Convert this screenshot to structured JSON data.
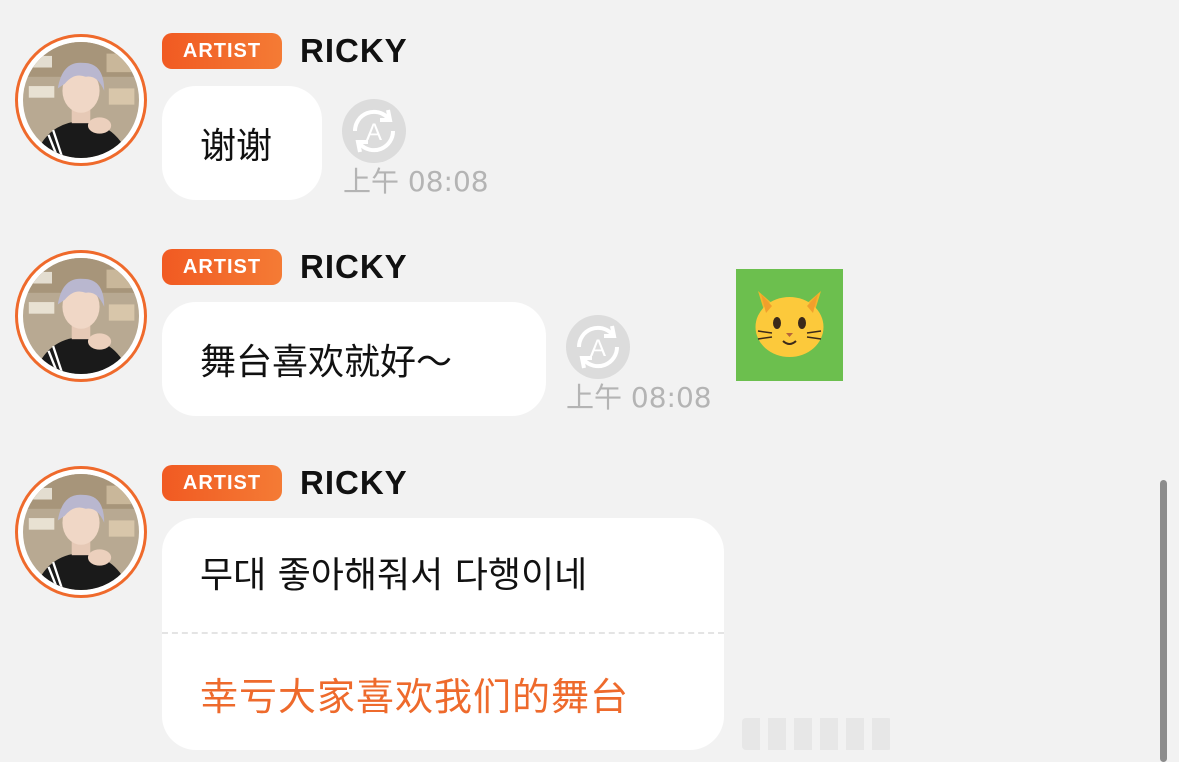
{
  "messages": [
    {
      "badge": "ARTIST",
      "sender": "RICKY",
      "text": "谢谢",
      "time": "上午 08:08"
    },
    {
      "badge": "ARTIST",
      "sender": "RICKY",
      "text": "舞台喜欢就好～",
      "time": "上午 08:08"
    },
    {
      "badge": "ARTIST",
      "sender": "RICKY",
      "original_text": "무대 좋아해줘서 다행이네",
      "translated_text": "幸亏大家喜欢我们的舞台"
    }
  ],
  "sticker": {
    "emoji": "cat-face-emoji",
    "background": "#6cbf4e"
  },
  "colors": {
    "accent": "#ef6a2c",
    "badge_start": "#f15a22",
    "badge_end": "#f47b35",
    "background": "#f2f2f2",
    "bubble": "#ffffff",
    "timestamp": "#b4b4b4"
  },
  "icons": {
    "translate": "translate-icon",
    "avatar": "avatar-photo"
  }
}
